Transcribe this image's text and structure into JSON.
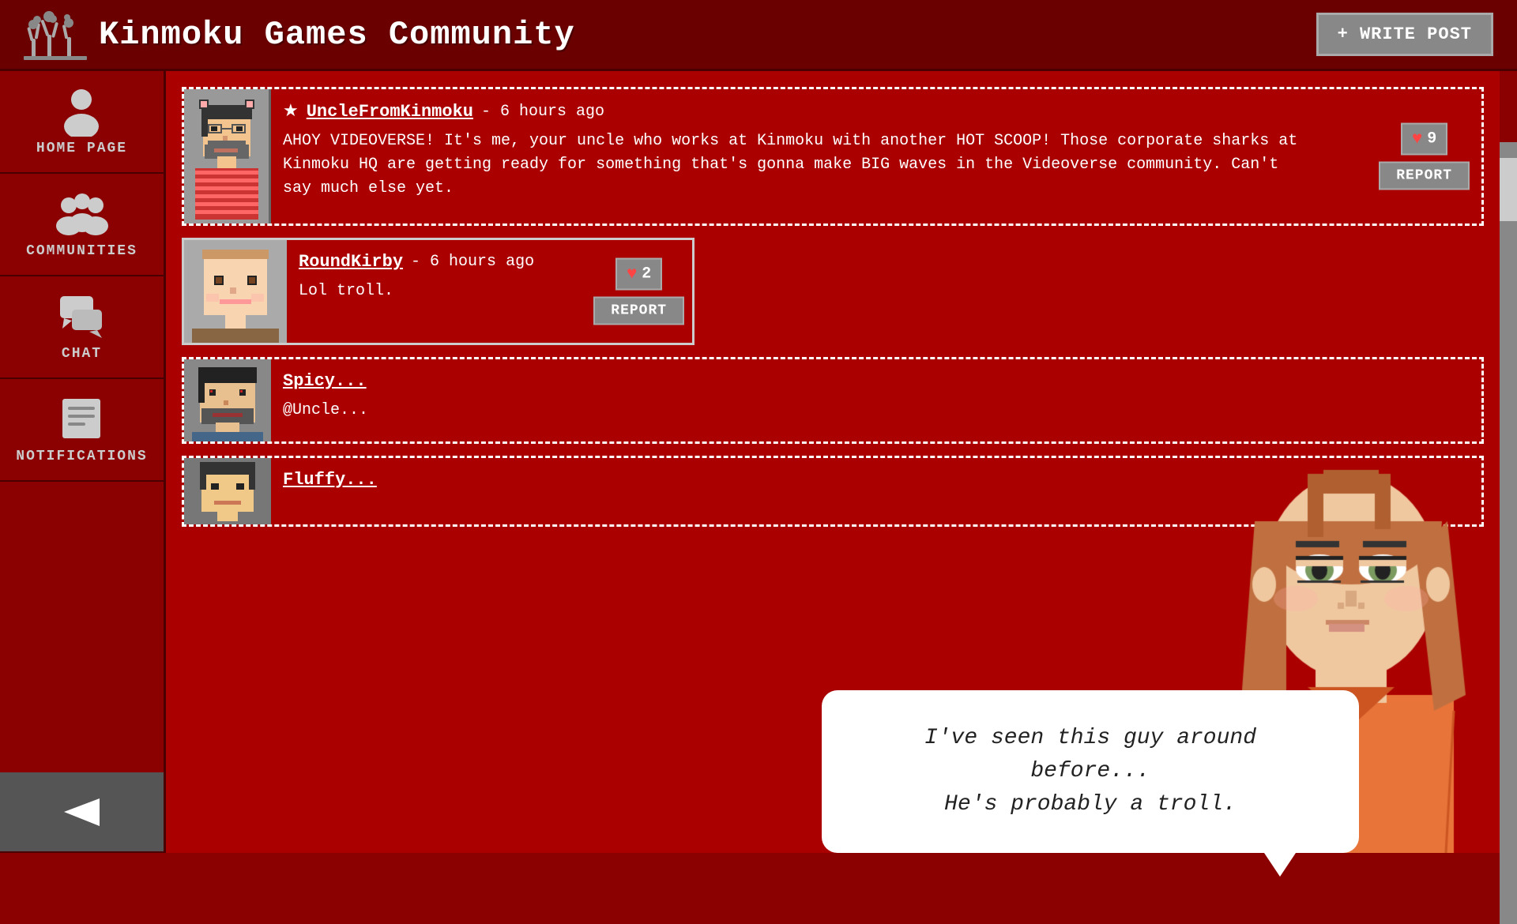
{
  "header": {
    "title": "Kinmoku Games Community",
    "write_post_label": "+ WRITE POST"
  },
  "sidebar": {
    "items": [
      {
        "id": "home",
        "label": "HOME PAGE",
        "icon": "person-icon"
      },
      {
        "id": "communities",
        "label": "COMMUNITIES",
        "icon": "group-icon"
      },
      {
        "id": "chat",
        "label": "CHAT",
        "icon": "chat-icon"
      },
      {
        "id": "notifications",
        "label": "NOTIFICATIONS",
        "icon": "notif-icon"
      },
      {
        "id": "back",
        "label": "",
        "icon": "back-icon"
      }
    ]
  },
  "posts": [
    {
      "id": "post1",
      "author": "UncleFromKinmoku",
      "starred": true,
      "time": "6 hours ago",
      "content": "AHOY VIDEOVERSE! It's me, your uncle who works at Kinmoku with another HOT SCOOP! Those corporate sharks at Kinmoku HQ are getting ready for something that's gonna make BIG waves in the Videoverse community. Can't say much else yet.",
      "likes": 9,
      "like_label": "9"
    },
    {
      "id": "post2",
      "author": "RoundKirby",
      "starred": false,
      "time": "6 hours ago",
      "content": "Lol troll.",
      "likes": 2,
      "like_label": "2"
    },
    {
      "id": "post3",
      "author": "Spicy...",
      "starred": false,
      "time": "",
      "content": "@Uncle...",
      "likes": 0,
      "like_label": ""
    },
    {
      "id": "post4",
      "author": "Fluffy...",
      "starred": false,
      "time": "",
      "content": "",
      "likes": 0,
      "like_label": ""
    }
  ],
  "dialog": {
    "line1": "I've seen this guy around before...",
    "line2": "He's probably a troll."
  },
  "colors": {
    "bg_dark": "#6b0000",
    "bg_main": "#aa0000",
    "sidebar_bg": "#8b0000",
    "border": "#cccccc",
    "text_white": "#ffffff",
    "btn_gray": "#888888"
  }
}
